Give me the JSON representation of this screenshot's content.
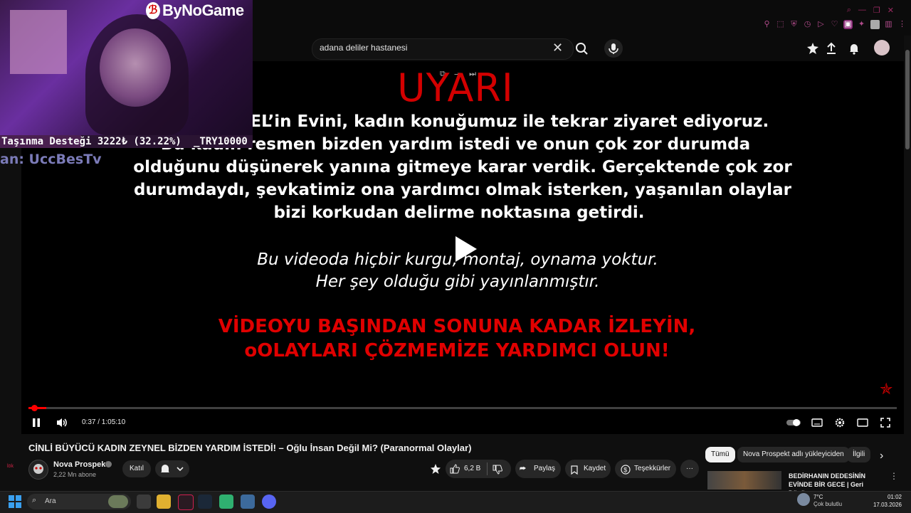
{
  "browser": {
    "min_glyph": "—",
    "max_glyph": "❐",
    "close_glyph": "✕"
  },
  "search": {
    "query": "adana deliler hastanesi",
    "clear_glyph": "✕"
  },
  "video": {
    "heading": "UYARI",
    "lines": [
      "EYNEL’in Evini, kadın konuğumuz ile tekrar ziyaret ediyoruz.",
      "Bu kadın resmen bizden yardım istedi ve onun çok zor durumda",
      "olduğunu düşünerek yanına gitmeye karar verdik. Gerçektende çok zor",
      "durumdaydı, şevkatimiz ona yardımcı olmak isterken, yaşanılan olaylar",
      "bizi korkudan delirme noktasına getirdi."
    ],
    "italic_lines": [
      "Bu videoda hiçbir kurgu, montaj, oynama yoktur.",
      "Her şey olduğu gibi yayınlanmıştır."
    ],
    "red_lines": [
      "VİDEOYU BAŞINDAN SONUNA KADAR İZLEYİN,",
      "oOLAYLARI ÇÖZMEMİZE YARDIMCI OLUN!"
    ],
    "time": "0:37 / 1:05:10",
    "progress": 0.0095,
    "star_glyph": "✯"
  },
  "overlay": {
    "brand": "ByNoGame",
    "donation_label": "Taşınma Desteği 3222₺ (32.22%)",
    "donation_goal": "_TRY10000",
    "streamer": "an: UccBesTv",
    "donation_progress": 0.3222
  },
  "page": {
    "title": "CİNLİ BÜYÜCÜ KADIN ZEYNEL BİZDEN YARDIM İSTEDİ! – Oğlu İnsan Değil Mi? (Paranormal Olaylar)",
    "channel": "Nova Prospekt",
    "subscribers": "2,22 Mn abone",
    "join": "Katıl",
    "likes": "6,2 B",
    "share": "Paylaş",
    "save": "Kaydet",
    "thanks": "Teşekkürler",
    "more_glyph": "···",
    "side_label": "lök"
  },
  "chips": [
    "Tümü",
    "Nova Prospekt adlı yükleyiciden",
    "İlgili"
  ],
  "recommendation": {
    "title_line1": "BEDİRHANIN DEDESİNİN",
    "title_line2": "EVİNDE BİR GECE | Geri Dönüş..."
  },
  "taskbar": {
    "search_label": "Ara",
    "temperature": "7°C",
    "weather": "Çok bulutlu",
    "time": "01:02",
    "date": "17.03.2026"
  }
}
